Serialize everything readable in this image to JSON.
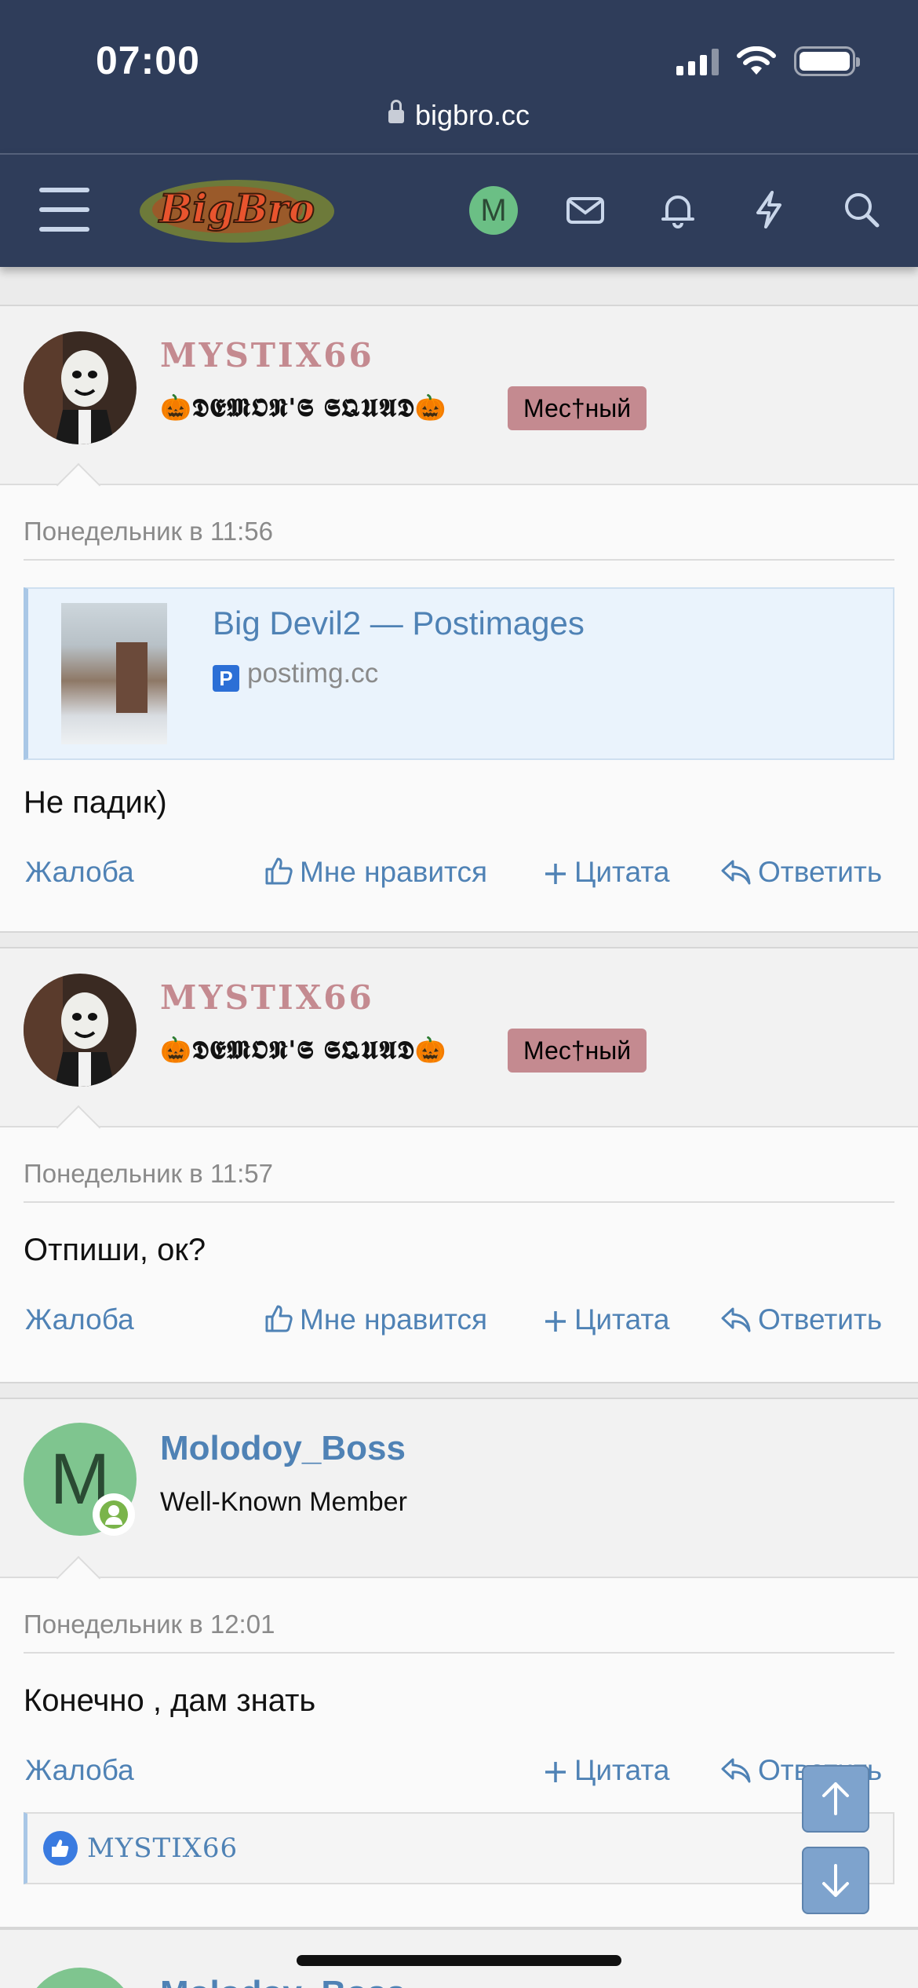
{
  "status_bar": {
    "time": "07:00"
  },
  "browser": {
    "url": "bigbro.cc"
  },
  "nav": {
    "logo_text": "BigBro",
    "avatar_letter": "M"
  },
  "posts": [
    {
      "username": "MYSTIX66",
      "user_title": "🎃𝕯𝕰𝕸𝕺𝕹'𝕾 𝕾𝕼𝖀𝕬𝕯🎃",
      "badge": "Мес†ный",
      "date": "Понедельник в 11:56",
      "embed": {
        "title": "Big Devil2 — Postimages",
        "site": "postimg.cc"
      },
      "message": "Не падик)",
      "actions": {
        "report": "Жалоба",
        "like": "Мне нравится",
        "quote": "Цитата",
        "reply": "Ответить"
      }
    },
    {
      "username": "MYSTIX66",
      "user_title": "🎃𝕯𝕰𝕸𝕺𝕹'𝕾 𝕾𝕼𝖀𝕬𝕯🎃",
      "badge": "Мес†ный",
      "date": "Понедельник в 11:57",
      "message": "Отпиши, ок?",
      "actions": {
        "report": "Жалоба",
        "like": "Мне нравится",
        "quote": "Цитата",
        "reply": "Ответить"
      }
    },
    {
      "username": "Molodoy_Boss",
      "avatar_letter": "M",
      "user_title": "Well-Known Member",
      "date": "Понедельник в 12:01",
      "message": "Конечно , дам знать",
      "actions": {
        "report": "Жалоба",
        "quote": "Цитата",
        "reply": "Ответить"
      },
      "reaction_user": "MYSTIX66"
    }
  ],
  "next_post_peek": {
    "username": "Molodoy_Boss"
  }
}
